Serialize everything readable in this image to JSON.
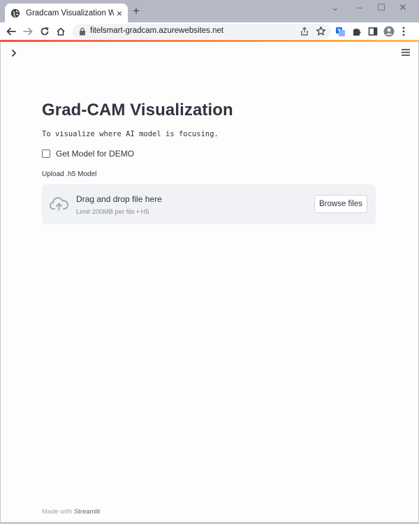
{
  "browser": {
    "tab_title": "Gradcam Visualization WebApp",
    "tab_close": "×",
    "new_tab": "+",
    "url": "fitelsmart-gradcam.azurewebsites.net",
    "window_controls": {
      "collapse": "⌄",
      "minimize": "–",
      "maximize": "☐",
      "close": "✕"
    }
  },
  "app": {
    "title": "Grad-CAM Visualization",
    "description": "To visualize where AI model is focusing.",
    "checkbox": {
      "label": "Get Model for DEMO",
      "checked": false
    },
    "uploader": {
      "label": "Upload .h5 Model",
      "drop_text": "Drag and drop file here",
      "limit_text": "Limit 200MB per file • H5",
      "button_label": "Browse files"
    },
    "footer": {
      "prefix": "Made with ",
      "link": "Streamlit"
    }
  },
  "colors": {
    "tab_strip": "#b5b9c6",
    "accent_start": "#ff4b4b",
    "accent_end": "#ffbd45",
    "text": "#31333f",
    "dropzone_bg": "#f0f2f6",
    "extension_blue": "#1a73e8"
  },
  "icons": [
    "globe-favicon-icon",
    "close-icon",
    "plus-icon",
    "chevron-down-icon",
    "minimize-icon",
    "maximize-icon",
    "window-close-icon",
    "back-arrow-icon",
    "forward-arrow-icon",
    "reload-icon",
    "home-icon",
    "lock-icon",
    "share-icon",
    "star-icon",
    "translate-extension-icon",
    "puzzle-icon",
    "side-panel-icon",
    "profile-avatar-icon",
    "kebab-menu-icon",
    "chevron-right-icon",
    "hamburger-menu-icon",
    "cloud-upload-icon"
  ]
}
